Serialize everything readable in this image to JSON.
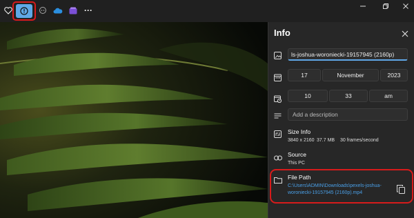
{
  "toolbar": {
    "icons": [
      "heart-icon",
      "info-icon",
      "people-icon",
      "cloud-icon",
      "clipchamp-icon",
      "more-icon"
    ],
    "more_label": "···"
  },
  "window": {
    "icons": [
      "minimize-icon",
      "restore-icon",
      "close-icon"
    ]
  },
  "info": {
    "title": "Info",
    "file_name": "ls-joshua-woroniecki-19157945 (2160p)",
    "date": {
      "day": "17",
      "month": "November",
      "year": "2023"
    },
    "time": {
      "hour": "10",
      "minute": "33",
      "ampm": "am"
    },
    "description_placeholder": "Add a description",
    "size_info": {
      "label": "Size Info",
      "resolution": "3840 x 2160",
      "size": "37.7 MB",
      "frame_rate": "30 frames/second"
    },
    "source": {
      "label": "Source",
      "value": "This PC"
    },
    "file_path": {
      "label": "File Path",
      "line1": "C:\\Users\\ADMIN\\Downloads\\pexels-joshua-",
      "line2": "woroniecki-19157945 (2160p).mp4"
    }
  },
  "colors": {
    "accent": "#4aa0e8",
    "highlight": "#d81b1b",
    "panel_bg": "#272727"
  }
}
